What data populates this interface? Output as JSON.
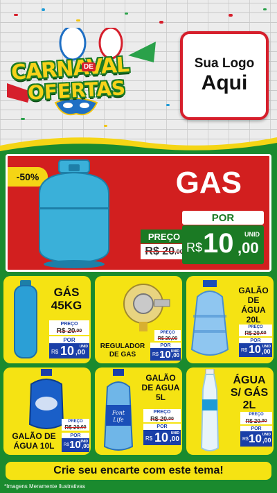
{
  "header": {
    "title_line1": "CARNAVAL",
    "title_de": "DE",
    "title_line2": "OFERTAS",
    "logo_line1": "Sua Logo",
    "logo_line2": "Aqui"
  },
  "colors": {
    "red": "#d21f1f",
    "green": "#1b7a24",
    "yellow": "#f5e313",
    "blue": "#1a3fa8"
  },
  "hero": {
    "badge": "-50%",
    "title": "GAS",
    "preco_label": "PREÇO",
    "old_price_int": "R$ 20",
    "old_price_dec": ",00",
    "por_label": "POR",
    "currency": "R$",
    "price_int": "10",
    "price_dec": ",00",
    "unit": "UNID"
  },
  "products": [
    {
      "name": "GÁS 45KG",
      "preco_label": "PREÇO",
      "old_int": "R$ 20",
      "old_dec": ",00",
      "por_label": "POR",
      "currency": "R$",
      "price_int": "10",
      "price_dec": ",00",
      "unit": "UNID",
      "icon": "gas-cylinder-tall-icon"
    },
    {
      "name": "REGULADOR DE GAS",
      "preco_label": "PREÇO",
      "old_int": "R$ 20",
      "old_dec": ",00",
      "por_label": "POR",
      "currency": "R$",
      "price_int": "10",
      "price_dec": ",00",
      "unit": "UNID",
      "icon": "gas-regulator-icon"
    },
    {
      "name": "GALÃO DE ÁGUA 20L",
      "preco_label": "PREÇO",
      "old_int": "R$ 20",
      "old_dec": ",00",
      "por_label": "POR",
      "currency": "R$",
      "price_int": "10",
      "price_dec": ",00",
      "unit": "UNID",
      "icon": "water-jug-20l-icon"
    },
    {
      "name": "GALÃO DE ÁGUA 10L",
      "preco_label": "PREÇO",
      "old_int": "R$ 20",
      "old_dec": ",00",
      "por_label": "POR",
      "currency": "R$",
      "price_int": "10",
      "price_dec": ",00",
      "unit": "UNID",
      "icon": "water-jug-10l-icon"
    },
    {
      "name": "GALÃO DE AGUA 5L",
      "preco_label": "PREÇO",
      "old_int": "R$ 20",
      "old_dec": ",00",
      "por_label": "POR",
      "currency": "R$",
      "price_int": "10",
      "price_dec": ",00",
      "unit": "UNID",
      "icon": "water-bottle-5l-icon",
      "brand": "Font Life"
    },
    {
      "name": "ÁGUA S/ GÁS 2L",
      "preco_label": "PREÇO",
      "old_int": "R$ 20",
      "old_dec": ",00",
      "por_label": "POR",
      "currency": "R$",
      "price_int": "10",
      "price_dec": ",00",
      "unit": "UNID",
      "icon": "water-bottle-2l-icon"
    }
  ],
  "footer": {
    "cta": "Crie seu encarte com este tema!",
    "disclaimer": "*Imagens Meramente Ilustrativas"
  }
}
